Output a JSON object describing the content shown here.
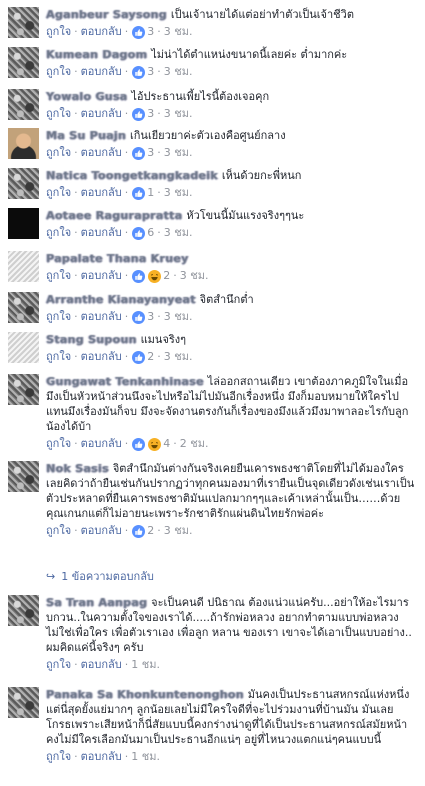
{
  "actions": {
    "like": "ถูกใจ",
    "reply": "ตอบกลับ",
    "sep": "·"
  },
  "icon_colors": {
    "like_bg": "#5890ff",
    "haha_bg": "#f7b125",
    "link": "#4b67a1",
    "meta": "#90949c"
  },
  "comments": [
    {
      "name": "Aganbeur Saysong",
      "text": "เป็นเจ้านายได้แต่อย่าทำตัวเป็นเจ้าชีวิต",
      "reactions": [
        "like"
      ],
      "count": "3",
      "time": "3 ชม."
    },
    {
      "name": "Kumean Dagom",
      "text": "ไม่น่าได้ตำแหน่งขนาดนี้เลยค่ะ ต่ำมากค่ะ",
      "reactions": [
        "like"
      ],
      "count": "3",
      "time": "3 ชม."
    },
    {
      "name": "Yowalo Gusa",
      "text": "ไอ้ประธานเพี้ยไรนี้ต้องเจอคุก",
      "reactions": [
        "like"
      ],
      "count": "3",
      "time": "3 ชม."
    },
    {
      "name": "Ma Su Puajn",
      "text": "เกินเยียวยาค่ะตัวเองคือศูนย์กลาง",
      "reactions": [
        "like"
      ],
      "count": "3",
      "time": "3 ชม."
    },
    {
      "name": "Natica Toongetkangkadeik",
      "text": "เห็นด้วยกะพี่หนก",
      "reactions": [
        "like"
      ],
      "count": "1",
      "time": "3 ชม."
    },
    {
      "name": "Aotaee Ragurapratta",
      "text": "หัวโขนนี้มันแรงจริงๆๆนะ",
      "reactions": [
        "like"
      ],
      "count": "6",
      "time": "3 ชม."
    },
    {
      "name": "Papalate Thana Kruey",
      "text": "",
      "reactions": [
        "like",
        "haha"
      ],
      "count": "2",
      "time": "3 ชม."
    },
    {
      "name": "Arranthe Kianayanyeat",
      "text": "จิตสำนึกต่ำ",
      "reactions": [
        "like"
      ],
      "count": "3",
      "time": "3 ชม."
    },
    {
      "name": "Stang Supoun",
      "text": "แมนจริงๆ",
      "reactions": [
        "like"
      ],
      "count": "2",
      "time": "3 ชม."
    },
    {
      "name": "Gungawat Tenkanhinase",
      "text": "ไล่ออกสถานเดียว เขาต้องภาคภูมิใจในเมื่อมึงเป็นหัวหน้าส่วนนึงจะไปหรือไม่ไปมันอีกเรื่องหนึ่ง มึงก็มอบหมายให้ใครไปแทนมึงเรื่องมันก็จบ มึงจะจัดงานตรงกันก็เรื่องของมึงแล้วมึงมาพาลอะไรกับลูกน้องได้บ้า",
      "reactions": [
        "like",
        "haha"
      ],
      "count": "4",
      "time": "2 ชม."
    },
    {
      "name": "Nok Sasis",
      "text": "จิตสำนึกมันต่างกันจริงเคยยืนเคารพธงชาติโดยที่ไม่ได้มองใครเลยคิดว่าถ้ายืนเช่นกันปรากฏว่าทุกคนมองมาที่เรายืนเป็นจุดเดียวดังเช่นเราเป็นตัวประหลาดที่ยืนเคารพธงชาติมันแปลกมากๆๆและเค้าเหล่านั้นเป็น……ด้วยคุณเกนกแต่ก็ไม่อายนะเพราะรักชาติรักแผ่นดินไทยรักพ่อค่ะ",
      "reactions": [
        "like"
      ],
      "count": "2",
      "time": "3 ชม."
    },
    {
      "name": "Sa Tran Aanpag",
      "text": "จะเป็นคนดี ปนิธาณ ต้องแน่วแน่ครับ...อย่าให้อะไรมารบกวน..ในความตั้งใจของเราได้.....ถ้ารักพ่อหลวง อยากทำตามแบบพ่อหลวง ไม่ใช่เพื่อใคร เพื่อตัวเราเอง เพื่อลูก หลาน ของเรา เขาจะได้เอาเป็นแบบอย่าง.. ผมคิดแค่นี้จริงๆ ครับ",
      "reactions": [],
      "count": "",
      "time": "1 ชม."
    },
    {
      "name": "Panaka Sa Khonkuntenonghon",
      "text": "มันคงเป็นประธานสหกรณ์แห่งหนึ่งแต่นี่สุดยั้งแย่มากๆ ลูกน้อยเลยไม่มีใครใจดีที่จะไปร่วมงานที่บ้านมัน มันเลยโกรธเพราะเสียหน้าก็นี่สัยแบบนี้คงกร่างน่าดูที่ได้เป็นประธานสหกรณ์สมัยหน้าคงไม่มีใครเลือกมันมาเป็นประธานอีกแน่ๆ อยู่ที่ไหนวงแตกแน่ๆคนแบบนี้",
      "reactions": [],
      "count": "",
      "time": "1 ชม."
    }
  ],
  "replies_link": {
    "label": "1 ข้อความตอบกลับ"
  }
}
